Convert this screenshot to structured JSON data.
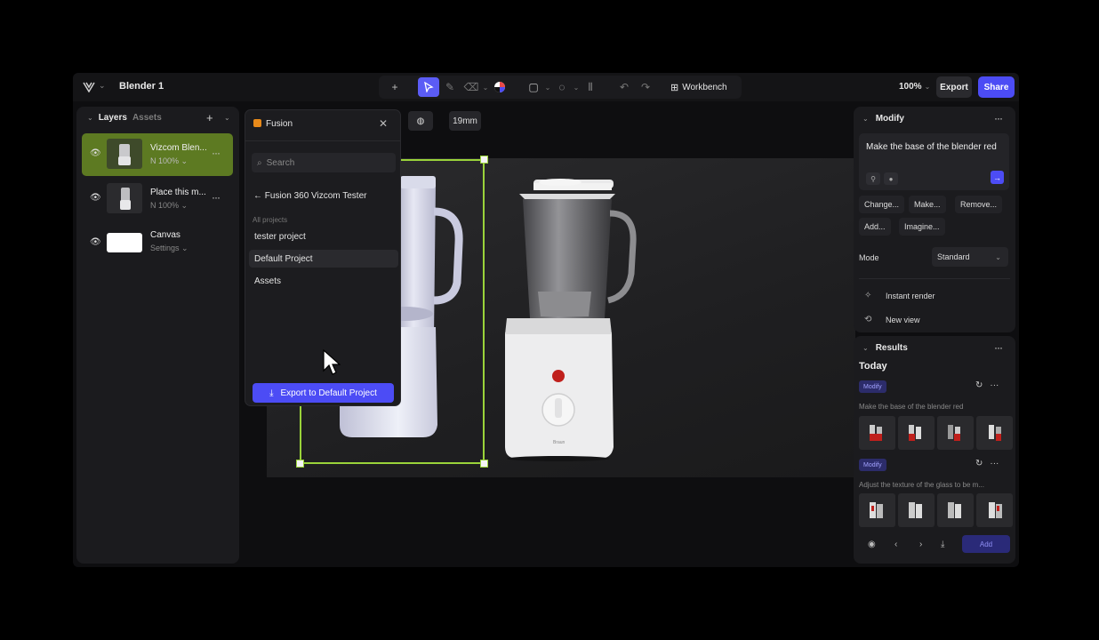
{
  "app": {
    "title": "Blender 1",
    "zoom": "100%",
    "export_label": "Export",
    "share_label": "Share",
    "workbench_label": "Workbench",
    "accent": "#4c4cf5",
    "selection_color": "#9ad33a"
  },
  "layers_panel": {
    "tab_layers": "Layers",
    "tab_assets": "Assets",
    "items": [
      {
        "name": "Vizcom Blen...",
        "sub": "N 100%",
        "selected": true,
        "icon": "eye-icon"
      },
      {
        "name": "Place this m...",
        "sub": "N 100%",
        "selected": false,
        "icon": "eye-icon"
      },
      {
        "name": "Canvas",
        "sub": "Settings",
        "selected": false,
        "icon": "eye-icon"
      }
    ]
  },
  "canvas_controls": {
    "size_value": "19mm"
  },
  "fusion": {
    "title": "Fusion",
    "search_placeholder": "Search",
    "back_label": "Fusion 360 Vizcom Tester",
    "section_label": "All projects",
    "projects": [
      "tester project",
      "Default Project",
      "Assets"
    ],
    "export_button": "Export to Default Project"
  },
  "modify": {
    "title": "Modify",
    "prompt": "Make the base of the blender red",
    "chips": [
      "Change...",
      "Make...",
      "Remove...",
      "Add...",
      "Imagine..."
    ],
    "mode_label": "Mode",
    "mode_value": "Standard",
    "actions": [
      "Instant render",
      "New view"
    ]
  },
  "results": {
    "title": "Results",
    "today": "Today",
    "groups": [
      {
        "badge": "Modify",
        "prompt": "Make the base of the blender red"
      },
      {
        "badge": "Modify",
        "prompt": "Adjust the texture of the glass to be m..."
      }
    ],
    "add_label": "Add"
  }
}
